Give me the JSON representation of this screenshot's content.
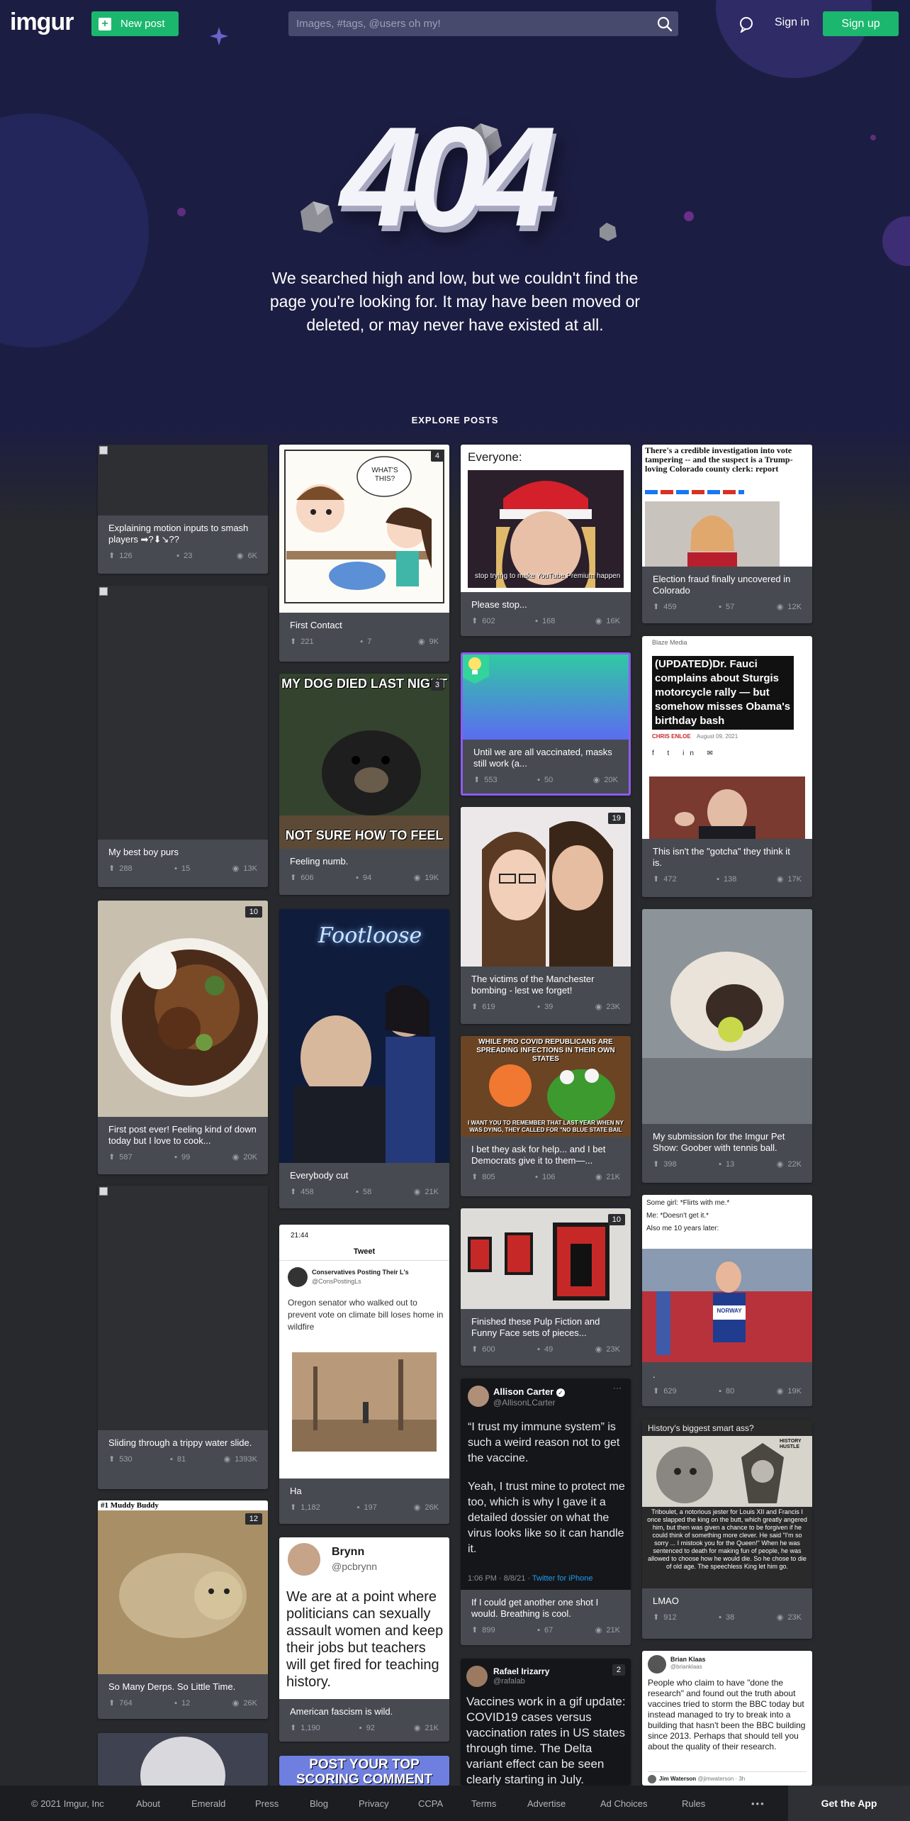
{
  "header": {
    "logo": "imgur",
    "new_post": "New post",
    "search_placeholder": "Images, #tags, @users oh my!",
    "sign_in": "Sign in",
    "sign_up": "Sign up"
  },
  "hero": {
    "code": "404",
    "message": "We searched high and low, but we couldn't find the page you're looking for. It may have been moved or deleted, or may never have existed at all."
  },
  "explore_label": "EXPLORE POSTS",
  "posts": {
    "c0": {
      "title": "Explaining motion inputs to smash players ➡?⬇↘??",
      "ups": "126",
      "comments": "23",
      "views": "6K"
    },
    "c1": {
      "title": "My best boy purs",
      "ups": "288",
      "comments": "15",
      "views": "13K"
    },
    "c2": {
      "title": "First post ever! Feeling kind of down today but I love to cook...",
      "ups": "587",
      "comments": "99",
      "views": "20K",
      "count": "10"
    },
    "c3": {
      "title": "Sliding through a trippy water slide.",
      "ups": "530",
      "comments": "81",
      "views": "1393K"
    },
    "c4": {
      "title": "So Many Derps. So Little Time.",
      "ups": "764",
      "comments": "12",
      "views": "26K",
      "count": "12",
      "caption": "#1 Muddy Buddy"
    },
    "c5": {
      "title": "First Contact",
      "ups": "221",
      "comments": "7",
      "views": "9K",
      "count": "4",
      "bubble": "WHAT'S THIS?"
    },
    "c6": {
      "title": "Feeling numb.",
      "ups": "606",
      "comments": "94",
      "views": "19K",
      "count": "3",
      "top_text": "MY DOG DIED LAST NIGHT",
      "bottom_text": "NOT SURE HOW TO FEEL"
    },
    "c7": {
      "title": "Everybody cut",
      "ups": "458",
      "comments": "58",
      "views": "21K",
      "sign": "Footloose"
    },
    "c8": {
      "title": "Ha",
      "ups": "1,182",
      "comments": "197",
      "views": "26K",
      "time": "21:44",
      "tweet_label": "Tweet",
      "account": "Conservatives Posting Their L's",
      "handle": "@ConsPostingLs",
      "text": "Oregon senator who walked out to prevent vote on climate bill loses home in wildfire"
    },
    "c9": {
      "title": "American fascism is wild.",
      "ups": "1,190",
      "comments": "92",
      "views": "21K",
      "name": "Brynn",
      "handle": "@pcbrynn",
      "text": "We are at a point where politicians can sexually assault women and keep their jobs but teachers will get fired for teaching history."
    },
    "c10": {
      "top_text": "POST YOUR TOP SCORING COMMENT"
    },
    "c11": {
      "title": "Please stop...",
      "ups": "602",
      "comments": "168",
      "views": "16K",
      "header_text": "Everyone:",
      "caption": "stop trying to make YouTube Premium happen"
    },
    "c12": {
      "title": "Until we are all vaccinated, masks still work (a...",
      "ups": "553",
      "comments": "50",
      "views": "20K"
    },
    "c13": {
      "title": "The victims of the Manchester bombing - lest we forget!",
      "ups": "619",
      "comments": "39",
      "views": "23K",
      "count": "19"
    },
    "c14": {
      "title": "I bet they ask for help... and I bet Democrats give it to them—...",
      "ups": "805",
      "comments": "106",
      "views": "21K",
      "top_text": "WHILE PRO COVID REPUBLICANS ARE SPREADING INFECTIONS IN THEIR OWN STATES",
      "bottom_text": "I WANT YOU TO REMEMBER THAT LAST YEAR WHEN NY WAS DYING, THEY CALLED FOR \"NO BLUE STATE BAIL"
    },
    "c15": {
      "title": "Finished these Pulp Fiction and Funny Face sets of pieces...",
      "ups": "600",
      "comments": "49",
      "views": "23K",
      "count": "10"
    },
    "c16": {
      "title": "If I could get another one shot I would. Breathing is cool.",
      "ups": "899",
      "comments": "67",
      "views": "21K",
      "name": "Allison Carter",
      "handle": "@AllisonLCarter",
      "quote": "“I trust my immune system” is such a weird reason not to get the vaccine.",
      "reply": "Yeah, I trust mine to protect me too, which is why I gave it a detailed dossier on what the virus looks like so it can handle it.",
      "meta": "1:06 PM · 8/8/21 · ",
      "client": "Twitter for iPhone"
    },
    "c17": {
      "count": "2",
      "name": "Rafael Irizarry",
      "handle": "@rafalab",
      "text": "Vaccines work in a gif update: COVID19 cases versus vaccination rates in US states through time. The Delta variant effect can be seen clearly starting in July."
    },
    "c18": {
      "title": "Election fraud finally uncovered in Colorado",
      "ups": "459",
      "comments": "57",
      "views": "12K",
      "headline": "There's a credible investigation into vote tampering -- and the suspect is a Trump-loving Colorado county clerk: report"
    },
    "c19": {
      "title": "This isn't the \"gotcha\" they think it is.",
      "ups": "472",
      "comments": "138",
      "views": "17K",
      "source": "Blaze Media",
      "headline": "(UPDATED)Dr. Fauci complains about Sturgis motorcycle rally — but somehow misses Obama's birthday bash",
      "author": "CHRIS ENLOE",
      "date": "August 09, 2021"
    },
    "c20": {
      "title": "My submission for the Imgur Pet Show: Goober with tennis ball.",
      "ups": "398",
      "comments": "13",
      "views": "22K"
    },
    "c21": {
      "title": ".",
      "ups": "629",
      "comments": "80",
      "views": "19K",
      "line1": "Some girl: *Flirts with me.*",
      "line2": "Me: *Doesn't get it.*",
      "line3": "Also me 10 years later:",
      "bib": "NORWAY"
    },
    "c22": {
      "title": "LMAO",
      "ups": "912",
      "comments": "38",
      "views": "23K",
      "header_text": "History's biggest smart ass?",
      "stamp": "HISTORY HUSTLE",
      "text": "Triboulet, a notorious jester for Louis XII and Francis I once slapped the king on the butt, which greatly angered him, but then was given a chance to be forgiven if he could think of something more clever. He said \"I'm so sorry ... I mistook you for the Queen!\" When he was sentenced to death for making fun of people, he was allowed to choose how he would die. So he chose to die of old age. The speechless King let him go."
    },
    "c23": {
      "name": "Brian Klaas",
      "handle": "@brianklaas",
      "text": "People who claim to have \"done the research\" and found out the truth about vaccines tried to storm the BBC today but instead managed to try to break into a building that hasn't been the BBC building since 2013. Perhaps that should tell you about the quality of their research.",
      "reply_name": "Jim Waterson",
      "reply_handle": "@jimwaterson · 3h"
    }
  },
  "footer": {
    "copyright": "© 2021 Imgur, Inc",
    "links": [
      "About",
      "Emerald",
      "Press",
      "Blog",
      "Privacy",
      "CCPA",
      "Terms",
      "Advertise",
      "Ad Choices",
      "Rules"
    ],
    "more": "•••",
    "get_app": "Get the App"
  },
  "colors": {
    "brand_green": "#1bb76e",
    "hero_bg": "#1c1d42",
    "page_bg": "#27292d",
    "card_bg": "#474a51",
    "promoted_border": "#8e5bf0"
  },
  "icons": [
    "plus-icon",
    "search-icon",
    "chat-bubble-icon",
    "upvote-arrow-icon",
    "comment-icon",
    "eye-icon",
    "verified-icon",
    "more-dots-icon",
    "promoted-bulb-icon"
  ]
}
